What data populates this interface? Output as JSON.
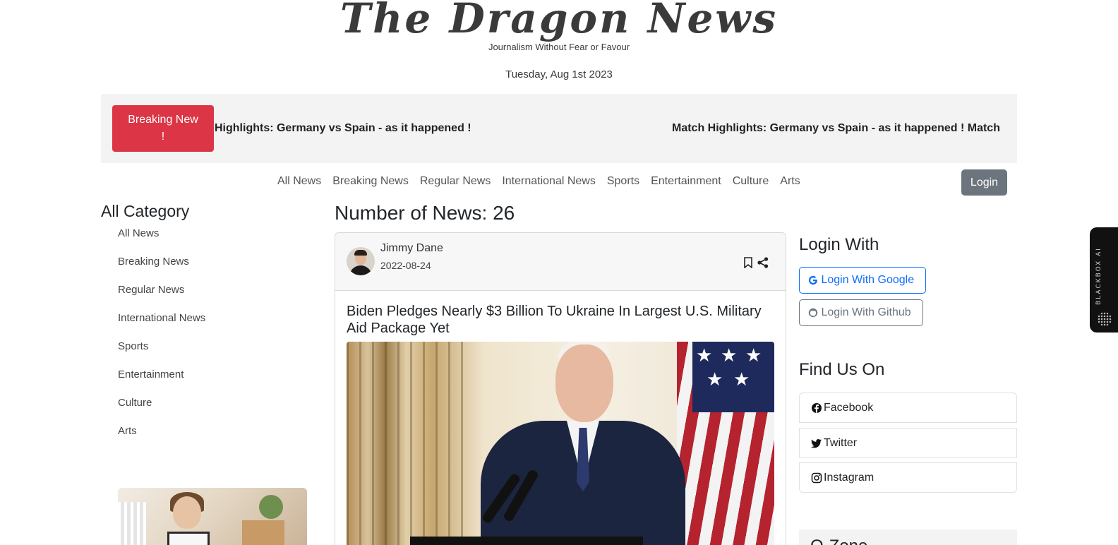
{
  "header": {
    "logo_text": "The Dragon News",
    "tagline": "Journalism Without Fear or Favour",
    "date": "Tuesday, Aug 1st 2023"
  },
  "ticker": {
    "button_label": "Breaking New !",
    "items": [
      "Highlights: Germany vs Spain - as it happened !",
      "Match Highlights: Germany vs Spain - as it happened ! Match"
    ]
  },
  "nav": {
    "items": [
      "All News",
      "Breaking News",
      "Regular News",
      "International News",
      "Sports",
      "Entertainment",
      "Culture",
      "Arts"
    ],
    "login_label": "Login"
  },
  "sidebar": {
    "title": "All Category",
    "items": [
      "All News",
      "Breaking News",
      "Regular News",
      "International News",
      "Sports",
      "Entertainment",
      "Culture",
      "Arts"
    ]
  },
  "main": {
    "count_title": "Number of News: 26",
    "card": {
      "author": "Jimmy Dane",
      "date": "2022-08-24",
      "title": "Biden Pledges Nearly $3 Billion To Ukraine In Largest U.S. Military Aid Package Yet"
    }
  },
  "right": {
    "login_title": "Login With",
    "google_label": "Login With Google",
    "github_label": "Login With Github",
    "find_title": "Find Us On",
    "social": [
      "Facebook",
      "Twitter",
      "Instagram"
    ],
    "qzone_title": "Q-Zone"
  },
  "blackbox": {
    "label": "BLACKBOX AI"
  },
  "colors": {
    "breaking_red": "#dc3545",
    "login_gray": "#6c757d",
    "google_blue": "#0d6efd"
  }
}
